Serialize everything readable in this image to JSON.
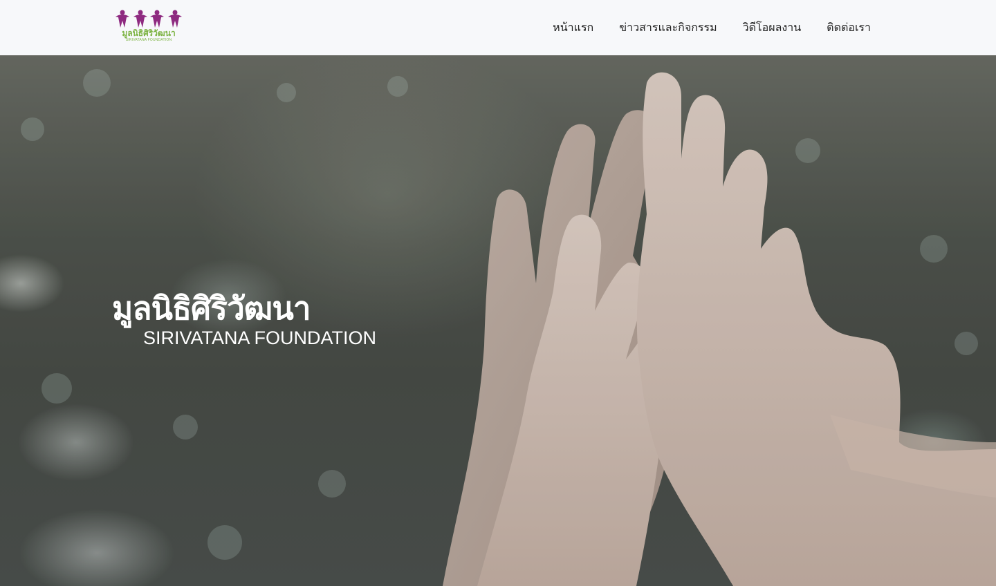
{
  "header": {
    "logo": {
      "thai_text": "มูลนิธิศิริวัฒนา",
      "english_text": "SIRIVATANA FOUNDATION",
      "icon": "people-figures-logo",
      "colors": {
        "figures": "#8e2a80",
        "text": "#7cb342"
      }
    },
    "nav": [
      {
        "label": "หน้าแรก"
      },
      {
        "label": "ข่าวสารและกิจกรรม"
      },
      {
        "label": "วิดีโอผลงาน"
      },
      {
        "label": "ติดต่อเรา"
      }
    ]
  },
  "hero": {
    "title": "มูลนิธิศิริวัฒนา",
    "subtitle": "SIRIVATANA FOUNDATION",
    "background": "hands-high-five-photo"
  }
}
